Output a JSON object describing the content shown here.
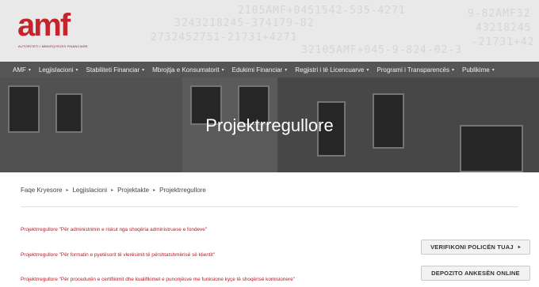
{
  "logo": {
    "text": "amf",
    "tagline": "AUTORITETI I MBIKËQYRJES FINANCIARE"
  },
  "header_pattern": [
    "2105AMF+0451542-535-4271",
    "3243218245-374179-82",
    "2732452751-21731+4271",
    "32105AMF+045-9-824-02-3",
    "9-82AMF32",
    "43218245",
    "-21731+42"
  ],
  "nav": {
    "items": [
      {
        "label": "AMF",
        "dropdown": true
      },
      {
        "label": "Legjislacioni",
        "dropdown": true
      },
      {
        "label": "Stabiliteti Financiar",
        "dropdown": true
      },
      {
        "label": "Mbrojtja e Konsumatorit",
        "dropdown": true
      },
      {
        "label": "Edukimi Financiar",
        "dropdown": true
      },
      {
        "label": "Regjistri i të Licencuarve",
        "dropdown": true
      },
      {
        "label": "Programi i Transparencës",
        "dropdown": true
      },
      {
        "label": "Publikime",
        "dropdown": true
      }
    ],
    "caret": "▾"
  },
  "hero": {
    "title": "Projektrregullore"
  },
  "breadcrumb": {
    "items": [
      "Faqe Kryesore",
      "Legjislacioni",
      "Projektakte",
      "Projektrregullore"
    ],
    "separator": "▸"
  },
  "documents": [
    "Projektrregullore \"Për administrimin e riskut nga shoqëria administruese e fondeve\"",
    "Projektrregullore \"Për formatin e pyetësorit të vlerësimit të përshtatshmërisë së klientit\"",
    "Projektrregullore \"Për procedurën e certifikimit dhe kualifikimet e punonjësve me funksione kyçe të shoqërisë komisionere\""
  ],
  "buttons": {
    "verify": "VERIFIKONI POLICËN TUAJ",
    "verify_arrow": "▸",
    "complaint": "DEPOZITO ANKESËN ONLINE"
  },
  "colors": {
    "brand_red": "#c4242b",
    "link_red": "#b31c25",
    "nav_bg": "#464646"
  }
}
